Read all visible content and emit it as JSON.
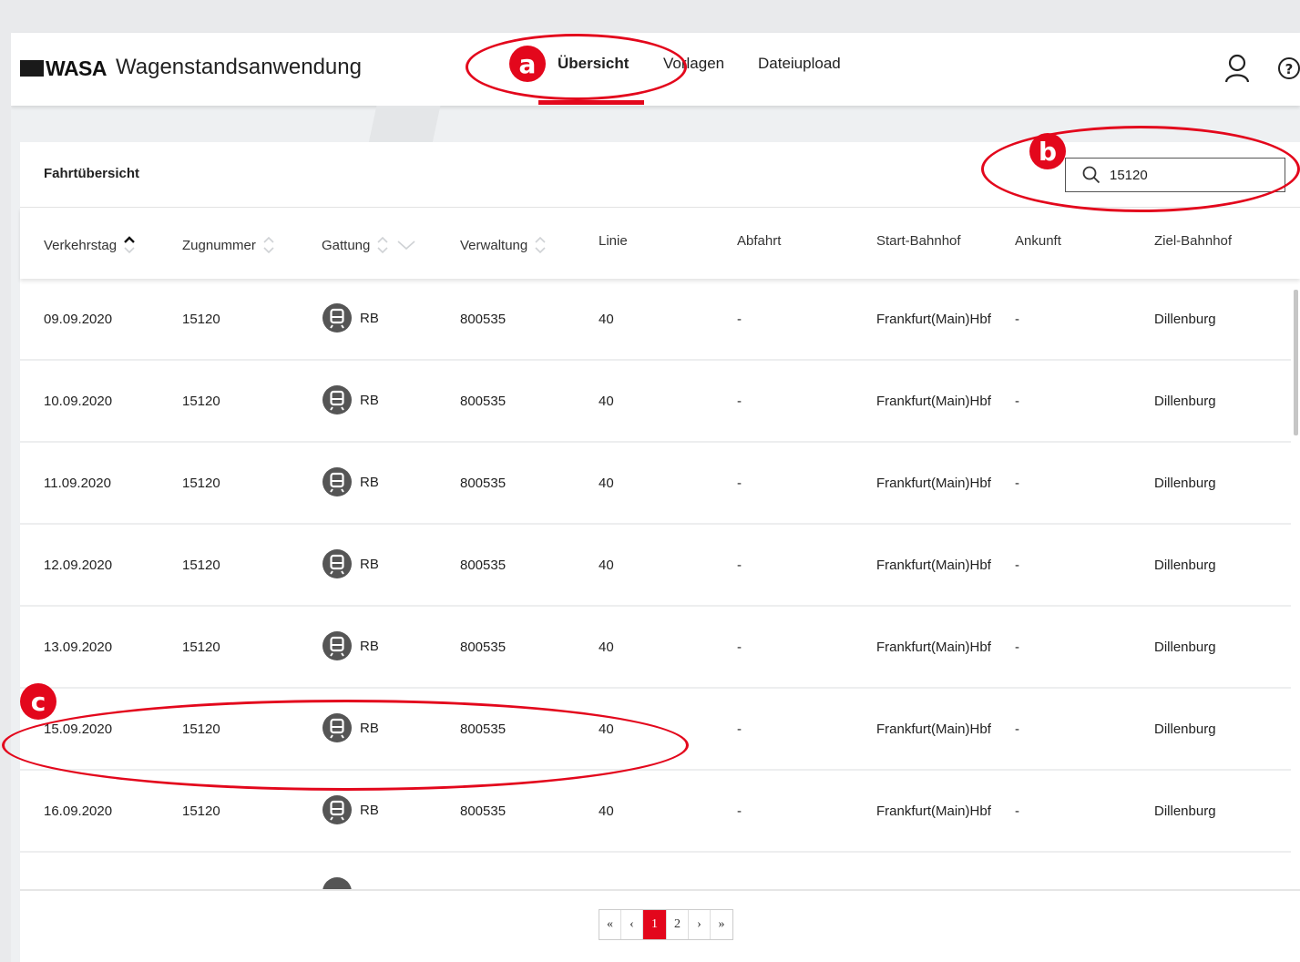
{
  "app": {
    "logo": "WASA",
    "title": "Wagenstandsanwendung"
  },
  "nav": {
    "items": [
      {
        "label": "Übersicht",
        "active": true
      },
      {
        "label": "Vorlagen",
        "active": false
      },
      {
        "label": "Dateiupload",
        "active": false
      }
    ]
  },
  "header_icons": [
    "user-icon",
    "help-icon"
  ],
  "card": {
    "title": "Fahrtübersicht"
  },
  "search": {
    "value": "15120",
    "icon": "search-icon"
  },
  "table": {
    "columns": [
      "Verkehrstag",
      "Zugnummer",
      "Gattung",
      "Verwaltung",
      "Linie",
      "Abfahrt",
      "Start-Bahnhof",
      "Ankunft",
      "Ziel-Bahnhof"
    ],
    "rows": [
      {
        "verkehrstag": "09.09.2020",
        "zugnummer": "15120",
        "gattung": "RB",
        "verwaltung": "800535",
        "linie": "40",
        "abfahrt": "-",
        "start": "Frankfurt(Main)Hbf",
        "ankunft": "-",
        "ziel": "Dillenburg"
      },
      {
        "verkehrstag": "10.09.2020",
        "zugnummer": "15120",
        "gattung": "RB",
        "verwaltung": "800535",
        "linie": "40",
        "abfahrt": "-",
        "start": "Frankfurt(Main)Hbf",
        "ankunft": "-",
        "ziel": "Dillenburg"
      },
      {
        "verkehrstag": "11.09.2020",
        "zugnummer": "15120",
        "gattung": "RB",
        "verwaltung": "800535",
        "linie": "40",
        "abfahrt": "-",
        "start": "Frankfurt(Main)Hbf",
        "ankunft": "-",
        "ziel": "Dillenburg"
      },
      {
        "verkehrstag": "12.09.2020",
        "zugnummer": "15120",
        "gattung": "RB",
        "verwaltung": "800535",
        "linie": "40",
        "abfahrt": "-",
        "start": "Frankfurt(Main)Hbf",
        "ankunft": "-",
        "ziel": "Dillenburg"
      },
      {
        "verkehrstag": "13.09.2020",
        "zugnummer": "15120",
        "gattung": "RB",
        "verwaltung": "800535",
        "linie": "40",
        "abfahrt": "-",
        "start": "Frankfurt(Main)Hbf",
        "ankunft": "-",
        "ziel": "Dillenburg"
      },
      {
        "verkehrstag": "15.09.2020",
        "zugnummer": "15120",
        "gattung": "RB",
        "verwaltung": "800535",
        "linie": "40",
        "abfahrt": "-",
        "start": "Frankfurt(Main)Hbf",
        "ankunft": "-",
        "ziel": "Dillenburg"
      },
      {
        "verkehrstag": "16.09.2020",
        "zugnummer": "15120",
        "gattung": "RB",
        "verwaltung": "800535",
        "linie": "40",
        "abfahrt": "-",
        "start": "Frankfurt(Main)Hbf",
        "ankunft": "-",
        "ziel": "Dillenburg"
      }
    ]
  },
  "pagination": {
    "first": "«",
    "prev": "‹",
    "pages": [
      "1",
      "2"
    ],
    "current": "1",
    "next": "›",
    "last": "»"
  },
  "annotations": {
    "a": "a",
    "b": "b",
    "c": "c"
  },
  "colors": {
    "accent": "#e3071c",
    "background": "#eef0f2"
  }
}
